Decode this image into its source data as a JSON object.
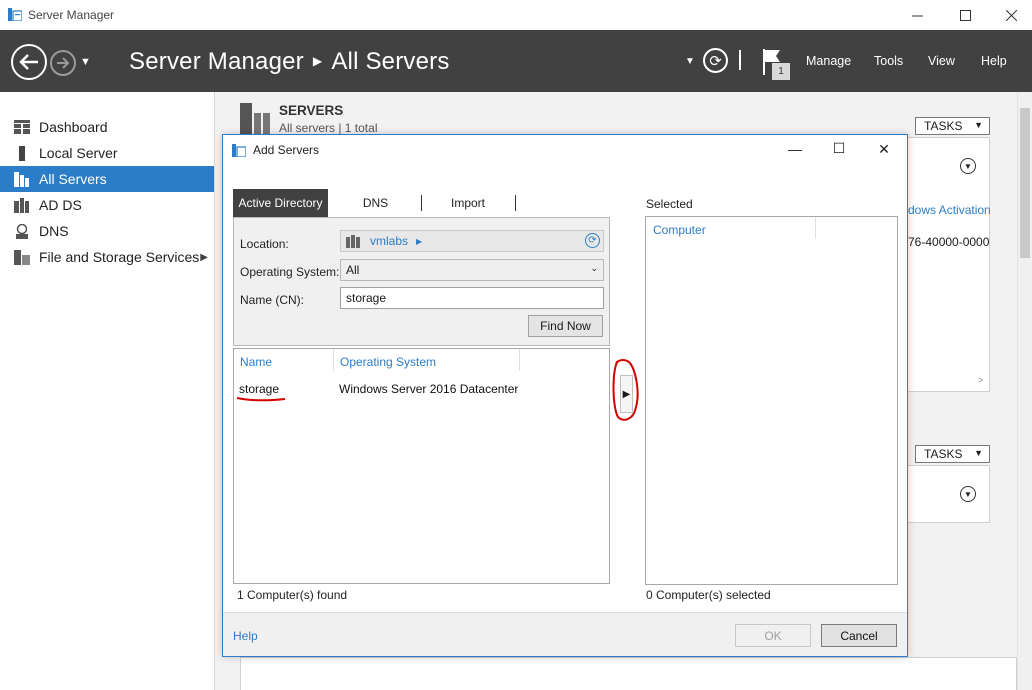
{
  "window": {
    "title": "Server Manager"
  },
  "header": {
    "breadcrumb_root": "Server Manager",
    "breadcrumb_current": "All Servers",
    "notification_count": "1",
    "menu": [
      "Manage",
      "Tools",
      "View",
      "Help"
    ]
  },
  "sidebar": {
    "items": [
      {
        "label": "Dashboard",
        "icon": "dashboard-icon"
      },
      {
        "label": "Local Server",
        "icon": "server-icon"
      },
      {
        "label": "All Servers",
        "icon": "servers-icon"
      },
      {
        "label": "AD DS",
        "icon": "adds-icon"
      },
      {
        "label": "DNS",
        "icon": "dns-icon"
      },
      {
        "label": "File and Storage Services",
        "icon": "file-storage-icon"
      }
    ]
  },
  "main": {
    "servers_title": "SERVERS",
    "servers_subtitle": "All servers | 1 total",
    "tasks_label": "TASKS",
    "bg_column_text": "dows Activation",
    "bg_cell_text": "76-40000-0000"
  },
  "dialog": {
    "title": "Add Servers",
    "tabs": [
      "Active Directory",
      "DNS",
      "Import"
    ],
    "location_label": "Location:",
    "location_value": "vmlabs",
    "os_label": "Operating System:",
    "os_value": "All",
    "name_label": "Name (CN):",
    "name_value": "storage",
    "find_now_label": "Find Now",
    "columns": [
      "Name",
      "Operating System"
    ],
    "results": [
      {
        "name": "storage",
        "os": "Windows Server 2016 Datacenter"
      }
    ],
    "found_status": "1 Computer(s) found",
    "selected_label": "Selected",
    "selected_column": "Computer",
    "selected_status": "0 Computer(s) selected",
    "help_label": "Help",
    "ok_label": "OK",
    "cancel_label": "Cancel"
  },
  "colors": {
    "accent": "#2c7dc7",
    "header_bg": "#414141",
    "annotation_red": "#d40000"
  }
}
